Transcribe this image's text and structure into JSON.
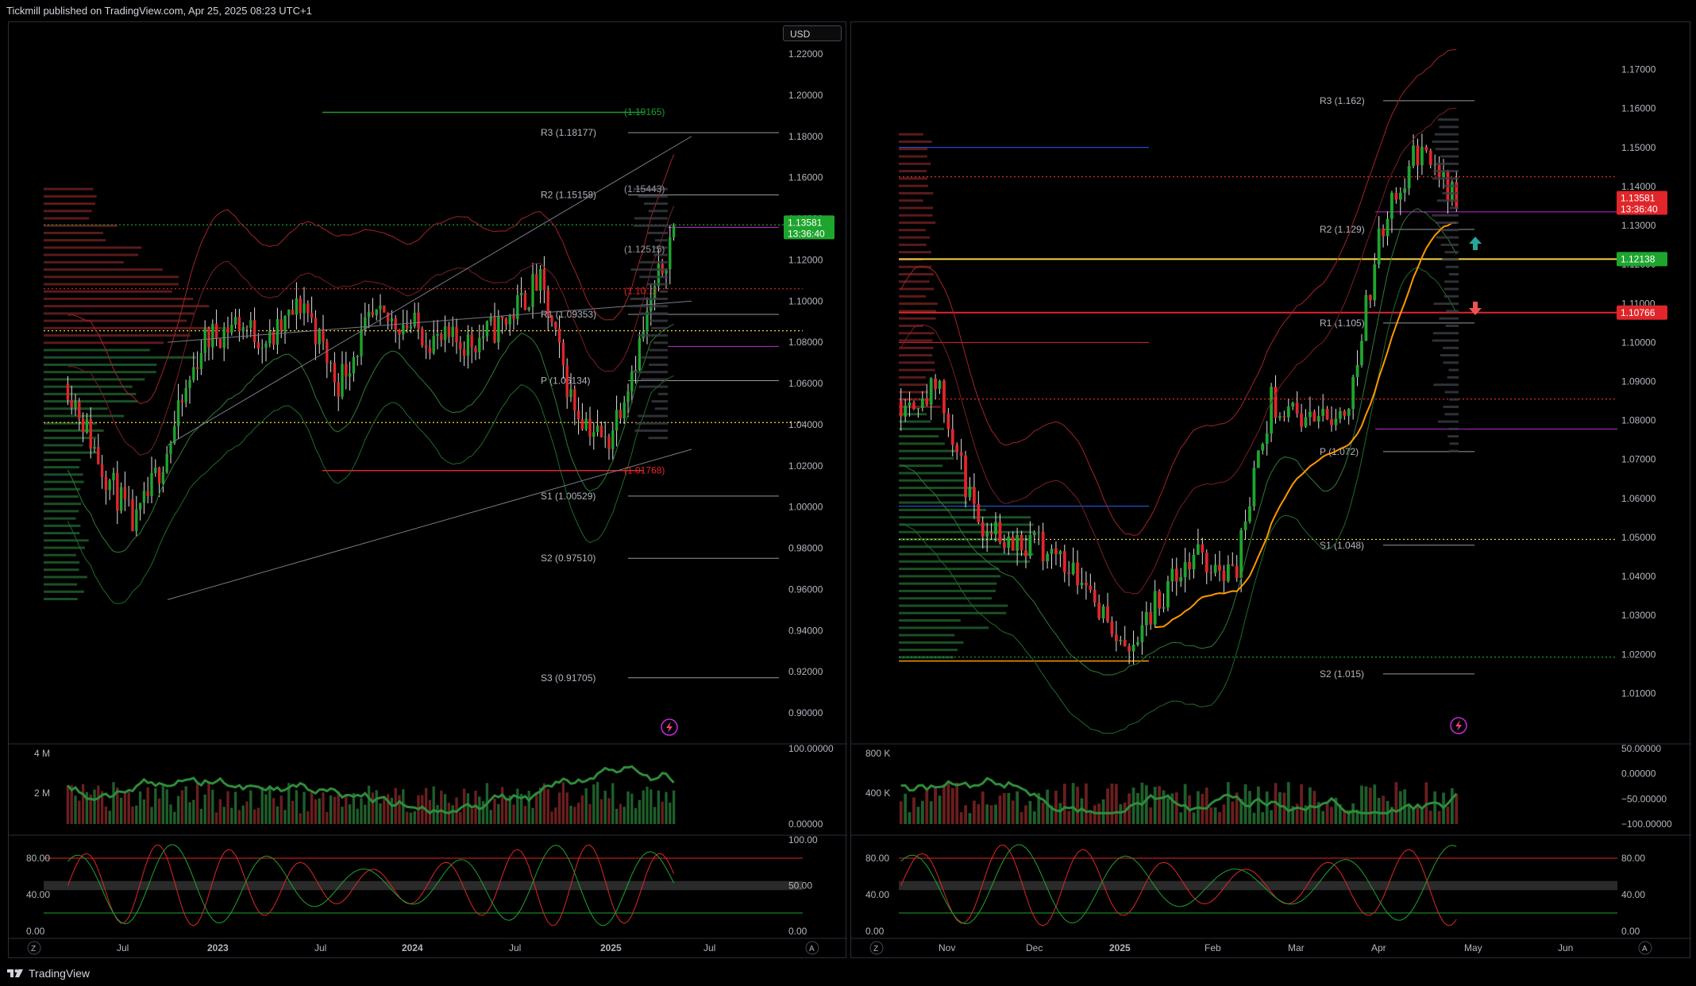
{
  "header": {
    "text": "Tickmill published on TradingView.com, Apr 25, 2025 08:23 UTC+1"
  },
  "footer": {
    "brand": "TradingView"
  },
  "icons": {
    "logo": "tradingview-logo-icon",
    "lightning": "lightning-icon",
    "zoom": "z-button-icon",
    "auto": "a-button-icon"
  },
  "colors": {
    "up": "#26a69a",
    "down": "#ef5350",
    "green": "#1e9c32",
    "red": "#e0262a",
    "yellow": "#f5d442",
    "orange": "#ff9800",
    "purple": "#c32bd8",
    "blue": "#2962ff"
  },
  "left_panel": {
    "currency": "USD",
    "price_axis": [
      "1.22000",
      "1.20000",
      "1.18000",
      "1.16000",
      "1.14000",
      "1.12000",
      "1.10000",
      "1.08000",
      "1.06000",
      "1.04000",
      "1.02000",
      "1.00000",
      "0.98000",
      "0.96000",
      "0.94000",
      "0.92000",
      "0.90000"
    ],
    "time_axis": [
      "Jul",
      "2023",
      "Jul",
      "2024",
      "Jul",
      "2025",
      "Jul"
    ],
    "zoom_label": "Z",
    "auto_label": "A",
    "last_price": "1.13581",
    "countdown": "13:36:40",
    "pivot_labels": [
      "R3 (1.18177)",
      "R2 (1.15158)",
      "R1 (1.09353)",
      "P (1.06134)",
      "S1 (1.00529)",
      "S2 (0.97510)",
      "S3 (0.91705)"
    ],
    "fib_labels": [
      "(1.19165)",
      "(1.15443)",
      "(1.12515)",
      "(1.10...)",
      "(1.01768)"
    ],
    "volume_axis": [
      "4 M",
      "2 M"
    ],
    "osc_axis": [
      "100.00000",
      "0.00000"
    ],
    "stoch_axis_left": [
      "80.00",
      "40.00",
      "0.00"
    ],
    "stoch_axis_right": [
      "100.00",
      "50.00",
      "0.00"
    ]
  },
  "right_panel": {
    "price_axis": [
      "1.17000",
      "1.16000",
      "1.15000",
      "1.14000",
      "1.13000",
      "1.12000",
      "1.11000",
      "1.10000",
      "1.09000",
      "1.08000",
      "1.07000",
      "1.06000",
      "1.05000",
      "1.04000",
      "1.03000",
      "1.02000",
      "1.01000"
    ],
    "time_axis": [
      "Nov",
      "Dec",
      "2025",
      "Feb",
      "Mar",
      "Apr",
      "May",
      "Jun"
    ],
    "zoom_label": "Z",
    "auto_label": "A",
    "last_price": "1.13581",
    "countdown": "13:36:40",
    "level_green": "1.12138",
    "level_red": "1.10766",
    "pivot_labels": [
      "R3 (1.162)",
      "R2 (1.129)",
      "R1 (1.105)",
      "P (1.072)",
      "S1 (1.048)",
      "S2 (1.015)"
    ],
    "volume_axis": [
      "800 K",
      "400 K"
    ],
    "osc_axis": [
      "50.00000",
      "0.00000",
      "−50.00000",
      "−100.00000"
    ],
    "stoch_axis": [
      "80.00",
      "40.00",
      "0.00"
    ]
  },
  "chart_data": [
    {
      "type": "line",
      "title": "",
      "xlabel": "",
      "ylabel": "USD",
      "x": [
        "2022-05",
        "2022-07",
        "2022-09",
        "2022-11",
        "2023-01",
        "2023-03",
        "2023-05",
        "2023-07",
        "2023-09",
        "2023-11",
        "2024-01",
        "2024-03",
        "2024-05",
        "2024-07",
        "2024-09",
        "2024-11",
        "2025-01",
        "2025-03",
        "2025-04"
      ],
      "series": [
        {
          "values": [
            1.06,
            1.02,
            0.99,
            1.03,
            1.08,
            1.09,
            1.08,
            1.1,
            1.06,
            1.09,
            1.09,
            1.08,
            1.08,
            1.09,
            1.11,
            1.05,
            1.03,
            1.08,
            1.1358
          ]
        }
      ],
      "ylim": [
        0.9,
        1.22
      ],
      "levels": {
        "R3": 1.18177,
        "R2": 1.15158,
        "R1": 1.09353,
        "P": 1.06134,
        "S1": 1.00529,
        "S2": 0.9751,
        "S3": 0.91705
      }
    },
    {
      "type": "line",
      "title": "",
      "xlabel": "",
      "ylabel": "",
      "x": [
        "2024-10-15",
        "2024-11-01",
        "2024-11-15",
        "2024-12-01",
        "2024-12-15",
        "2025-01-01",
        "2025-01-13",
        "2025-02-01",
        "2025-02-15",
        "2025-03-01",
        "2025-03-10",
        "2025-03-25",
        "2025-04-01",
        "2025-04-11",
        "2025-04-21",
        "2025-04-25"
      ],
      "series": [
        {
          "values": [
            1.085,
            1.088,
            1.055,
            1.05,
            1.047,
            1.04,
            1.02,
            1.035,
            1.045,
            1.04,
            1.085,
            1.08,
            1.082,
            1.13,
            1.15,
            1.1358
          ]
        }
      ],
      "ylim": [
        1.005,
        1.175
      ],
      "levels": {
        "R3": 1.162,
        "R2": 1.129,
        "R1": 1.105,
        "P": 1.072,
        "S1": 1.048,
        "S2": 1.015
      }
    }
  ]
}
